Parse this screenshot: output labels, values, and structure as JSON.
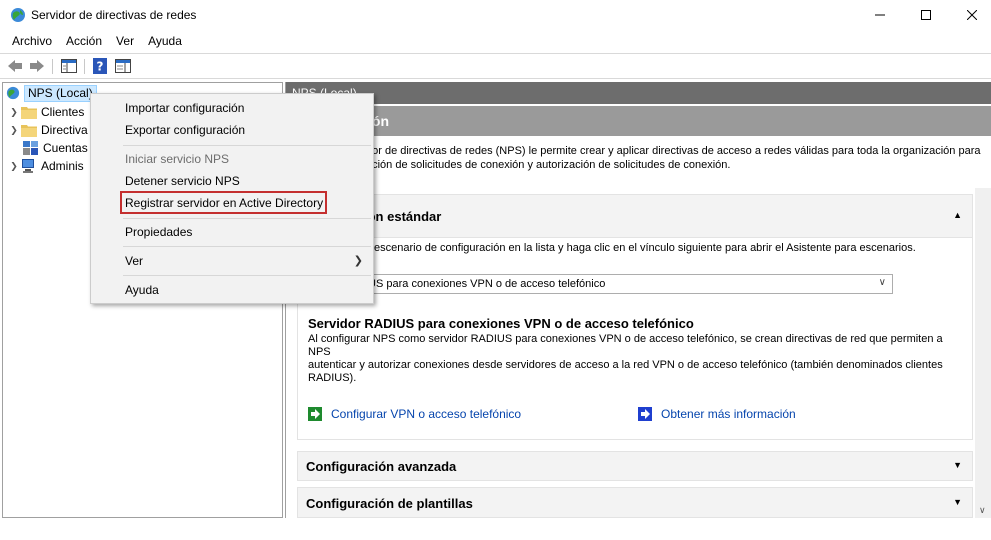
{
  "window": {
    "title": "Servidor de directivas de redes",
    "app_icon": "globe-icon",
    "controls": [
      "minimize-icon",
      "maximize-icon",
      "close-icon"
    ]
  },
  "menubar": {
    "items": [
      "Archivo",
      "Acción",
      "Ver",
      "Ayuda"
    ]
  },
  "toolbar": {
    "buttons": [
      "back-arrow-icon",
      "forward-arrow-icon",
      "show-hide-console-tree-icon",
      "help-icon",
      "action-pane-icon"
    ]
  },
  "tree": {
    "root": "NPS (Local)",
    "children": [
      "Clientes",
      "Directiva",
      "Cuentas",
      "Adminis"
    ]
  },
  "context_menu": {
    "items": [
      {
        "label": "Importar configuración",
        "enabled": true
      },
      {
        "label": "Exportar configuración",
        "enabled": true
      },
      {
        "label": "Iniciar servicio NPS",
        "enabled": false
      },
      {
        "label": "Detener servicio NPS",
        "enabled": true
      },
      {
        "label": "Registrar servidor en Active Directory",
        "enabled": true,
        "highlighted": true
      },
      {
        "label": "Propiedades",
        "enabled": true
      },
      {
        "label": "Ver",
        "enabled": true,
        "submenu": true
      },
      {
        "label": "Ayuda",
        "enabled": true
      }
    ]
  },
  "right": {
    "header": "NPS (Local)",
    "title": "ión",
    "description_line1": "dor de directivas de redes (NPS) le permite crear y aplicar directivas de acceso a redes válidas para toda la organización para",
    "description_line2": "ación de solicitudes de conexión y autorización de solicitudes de conexión.",
    "standard": {
      "title": "ión estándar",
      "instruction": "escenario de configuración en la lista y haga clic en el vínculo siguiente para abrir el Asistente para escenarios.",
      "selected_scenario": "IUS para conexiones VPN o de acceso telefónico",
      "sub_title": "Servidor RADIUS para conexiones VPN o de acceso telefónico",
      "sub_desc_line1": "Al configurar NPS como servidor RADIUS para conexiones VPN o de acceso telefónico, se crean directivas de red que permiten a NPS",
      "sub_desc_line2": "autenticar y autorizar conexiones desde servidores de acceso a la red VPN o de acceso telefónico (también denominados clientes",
      "sub_desc_line3": "RADIUS).",
      "link_configure": "Configurar VPN o acceso telefónico",
      "link_more": "Obtener más información"
    },
    "advanced_title": "Configuración avanzada",
    "templates_title": "Configuración de plantillas"
  },
  "colors": {
    "header_bg": "#6d6d6d",
    "title_bg": "#9a9a9a",
    "link": "#0645ad",
    "highlight_border": "#c42f2f",
    "selection_bg": "#cce8ff"
  }
}
